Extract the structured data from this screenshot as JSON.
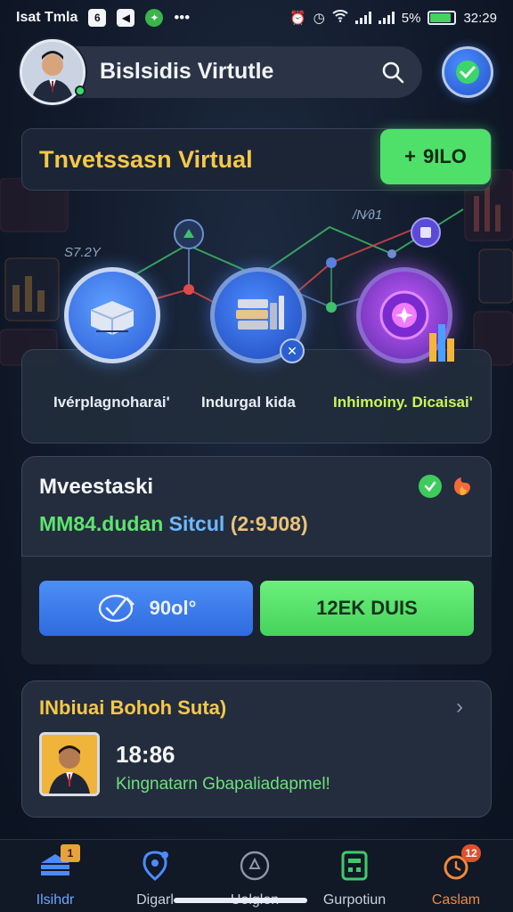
{
  "status_bar": {
    "app_text": "Isat Tmla",
    "app_icons": [
      "6",
      "◀"
    ],
    "dots": "•••",
    "battery_percent": "5%",
    "time": "32:29",
    "battery_level": 0.85
  },
  "header": {
    "title": "Bislsidis Virtutle",
    "search_icon": "search-icon",
    "badge_icon": "check-badge-icon"
  },
  "invest_banner": {
    "title": "Tnvetssasn Virtual",
    "button_label": "9ILO",
    "button_prefix": "+"
  },
  "network": {
    "label_left": "S7.2Y",
    "label_right": "/Ν⁄∂1"
  },
  "categories": [
    {
      "label": "Ivérplagnoharai'",
      "icon": "cube-icon"
    },
    {
      "label": "Indurgal kida",
      "icon": "stack-icon"
    },
    {
      "label": "Inhimoiny. Dicaisai'",
      "icon": "orb-icon"
    }
  ],
  "investasi": {
    "title": "Mveestaski",
    "sub_green": "MM84.dudan",
    "sub_blue": "Sitcul",
    "sub_orange": "(2:9J08)",
    "btn_blue_label": "90ol°",
    "btn_green_label": "12EK DUIS"
  },
  "individual": {
    "title": "INbiuai Bohoh Suta)",
    "time": "18:86",
    "desc": "Kingnatarn Gbapaliadapmel!"
  },
  "nav": [
    {
      "label": "Ilsihdr",
      "icon": "home-stack-icon",
      "badge": "1"
    },
    {
      "label": "Digarl",
      "icon": "location-pin-icon"
    },
    {
      "label": "Uolglen",
      "icon": "recycle-icon"
    },
    {
      "label": "Gurpotiun",
      "icon": "calculator-icon"
    },
    {
      "label": "Caslam",
      "icon": "notification-icon",
      "badge": "12"
    }
  ]
}
